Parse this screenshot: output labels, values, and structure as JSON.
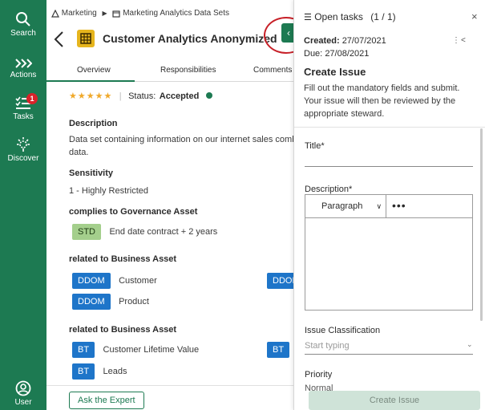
{
  "nav": {
    "search": "Search",
    "actions": "Actions",
    "tasks": "Tasks",
    "tasks_badge": "1",
    "discover": "Discover",
    "user": "User"
  },
  "breadcrumb": {
    "root": "Marketing",
    "child": "Marketing Analytics Data Sets"
  },
  "asset": {
    "title": "Customer Analytics Anonymized"
  },
  "tabs": [
    "Overview",
    "Responsibilities",
    "Comments (("
  ],
  "overview": {
    "stars": "★★★★★",
    "status_label": "Status:",
    "status_value": "Accepted",
    "description_heading": "Description",
    "description_line1": "Data set containing information on our internet sales combi",
    "description_line2": "data.",
    "sensitivity_heading": "Sensitivity",
    "sensitivity_value": "1 - Highly Restricted",
    "governance_heading": "complies to Governance Asset",
    "governance_tag": "STD",
    "governance_value": "End date contract + 2 years",
    "business1_heading": "related to Business Asset",
    "b1_tag1": "DDOM",
    "b1_val1": "Customer",
    "b1_tag2": "DDOM",
    "b1_tag3": "DDOM",
    "b1_val3": "Product",
    "business2_heading": "related to Business Asset",
    "b2_tag1": "BT",
    "b2_val1": "Customer Lifetime Value",
    "b2_tag2": "BT",
    "b2_tag3": "BT",
    "b2_val3": "Leads",
    "ask_button": "Ask the Expert"
  },
  "panel": {
    "header": "Open tasks",
    "count": "(1 / 1)",
    "created_label": "Created:",
    "created_value": "27/07/2021",
    "due_label": "Due:",
    "due_value": "27/08/2021",
    "title": "Create Issue",
    "description": "Fill out the mandatory fields and submit. Your issue will then be reviewed by the appropriate steward.",
    "title_field_label": "Title*",
    "description_field_label": "Description*",
    "paragraph_select": "Paragraph",
    "more_label": "•••",
    "classification_label": "Issue Classification",
    "classification_placeholder": "Start typing",
    "priority_label": "Priority",
    "priority_value": "Normal",
    "create_button": "Create Issue"
  },
  "colors": {
    "brand_green": "#1d7a52",
    "tag_blue": "#1e75c9",
    "tag_std": "#a4cf8c",
    "badge_red": "#d8232a",
    "star_orange": "#f0a92a"
  }
}
